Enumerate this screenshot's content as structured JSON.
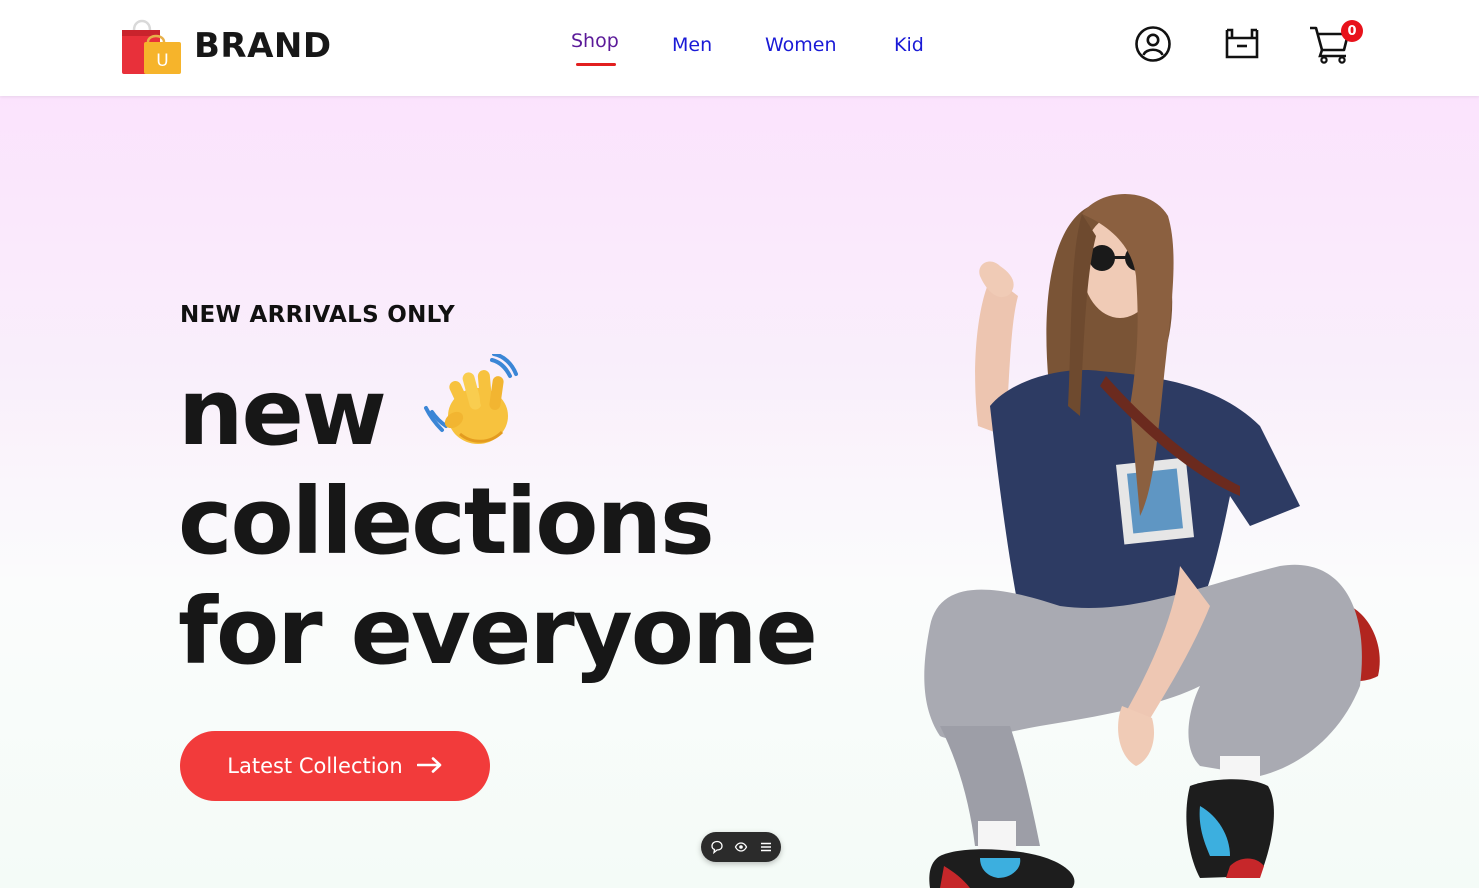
{
  "brand": {
    "name": "BRAND",
    "logo_letter": "U",
    "colors": {
      "bag_red": "#e8303a",
      "bag_yellow": "#f6b42b"
    }
  },
  "nav": {
    "items": [
      {
        "label": "Shop",
        "active": true
      },
      {
        "label": "Men",
        "active": false
      },
      {
        "label": "Women",
        "active": false
      },
      {
        "label": "Kid",
        "active": false
      }
    ],
    "active_color": "#5b1a99",
    "link_color": "#1a1ad6",
    "underline_color": "#e21f1f"
  },
  "header_icons": {
    "account": "user-circle-icon",
    "wishlist": "box-icon",
    "cart": "cart-icon",
    "cart_count": "0"
  },
  "hero": {
    "eyebrow": "NEW ARRIVALS ONLY",
    "headline_line1": "new",
    "headline_line2": "collections",
    "headline_line3": "for everyone",
    "wave_icon": "waving-hand-icon",
    "cta_label": "Latest Collection",
    "cta_icon": "arrow-right-icon",
    "cta_color": "#f23b3b"
  },
  "floating_toolbar": {
    "icons": [
      "comment-icon",
      "eye-icon",
      "list-icon"
    ]
  }
}
